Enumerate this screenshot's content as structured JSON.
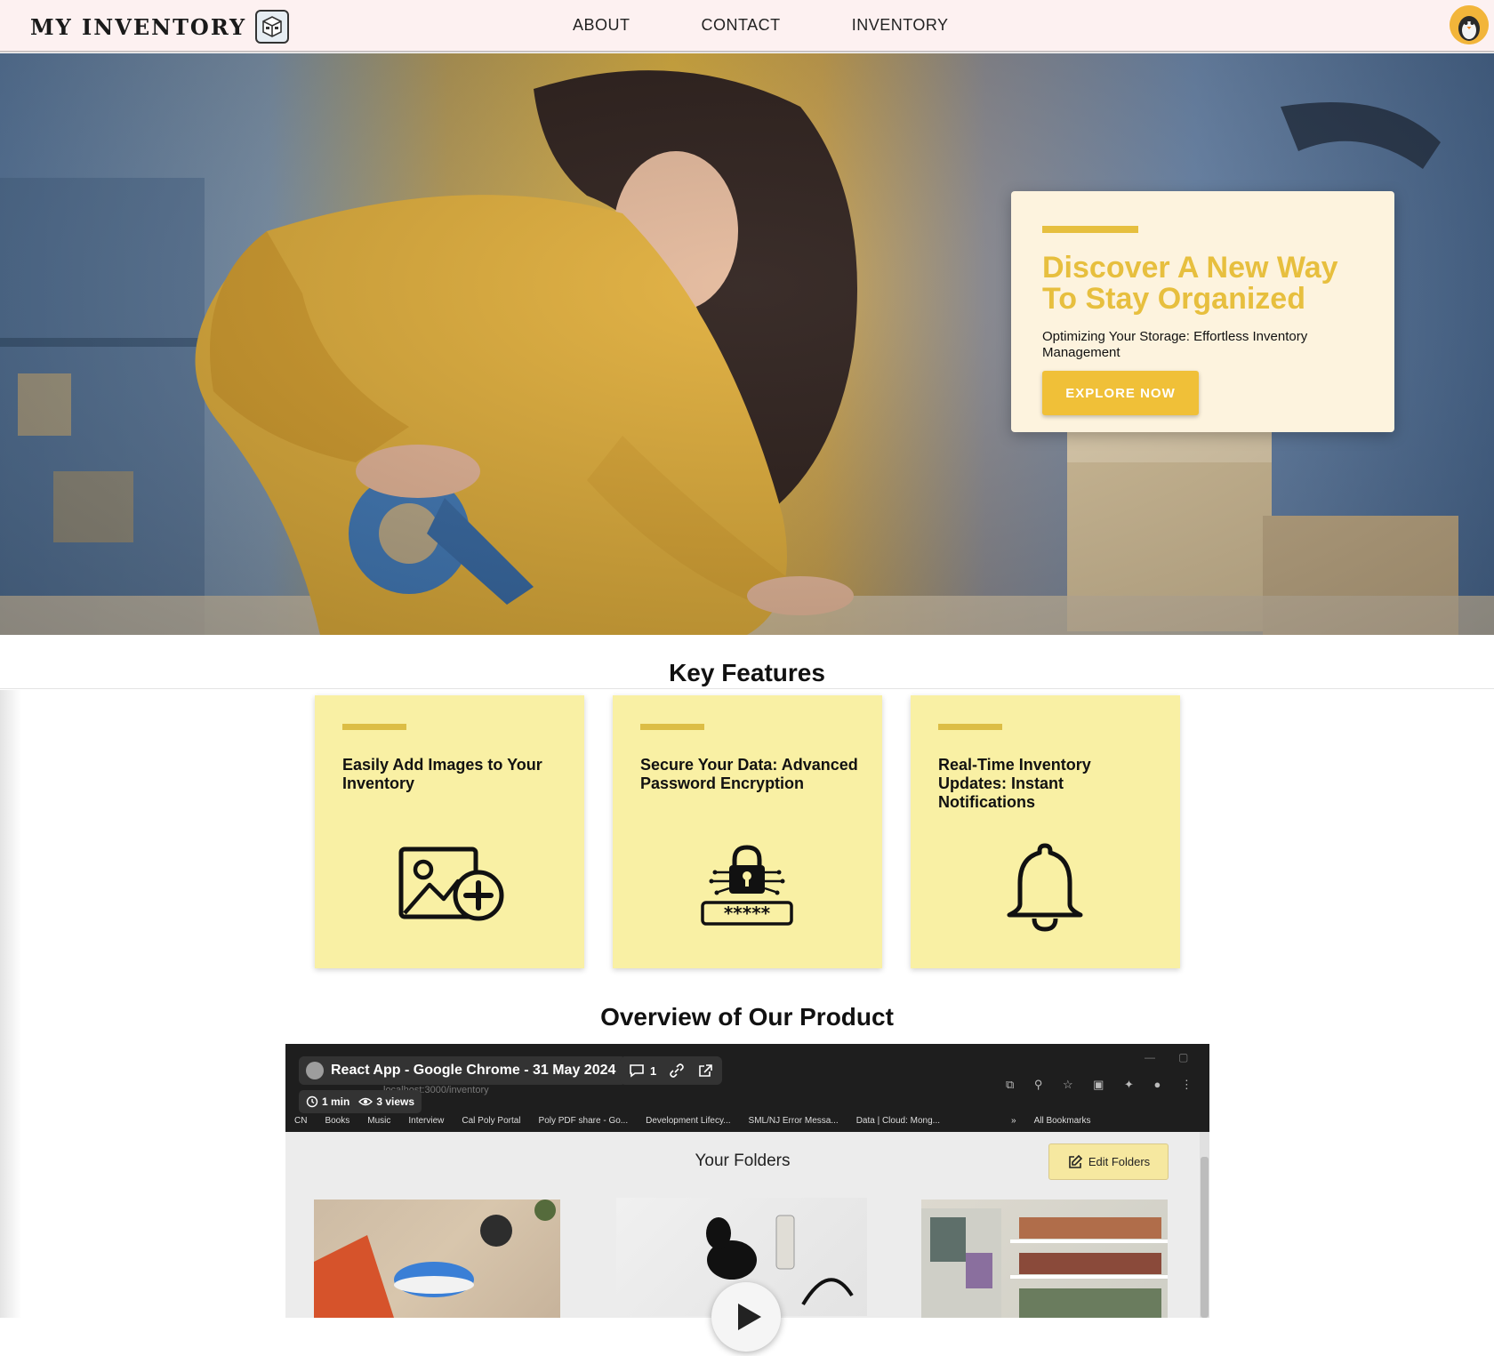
{
  "navbar": {
    "brand": "MY INVENTORY",
    "links": [
      "ABOUT",
      "CONTACT",
      "INVENTORY"
    ]
  },
  "hero": {
    "title": "Discover A New Way To Stay Organized",
    "subtitle": "Optimizing Your Storage: Effortless Inventory Management",
    "cta": "EXPLORE NOW"
  },
  "features": {
    "title": "Key Features",
    "items": [
      {
        "text": "Easily Add Images to Your Inventory",
        "icon": "add-image-icon"
      },
      {
        "text": "Secure Your Data: Advanced Password Encryption",
        "icon": "password-lock-icon"
      },
      {
        "text": "Real-Time Inventory Updates: Instant Notifications",
        "icon": "bell-icon"
      }
    ]
  },
  "overview": {
    "title": "Overview of Our Product",
    "video": {
      "title": "React App - Google Chrome - 31 May 2024",
      "comments": "1",
      "duration": "1 min",
      "views": "3 views",
      "url": "localhost:3000/inventory",
      "bookmarks": [
        "CN",
        "Books",
        "Music",
        "Interview",
        "Cal Poly Portal",
        "Poly PDF share - Go...",
        "Development Lifecy...",
        "SML/NJ Error Messa...",
        "Data | Cloud: Mong...",
        "»",
        "All Bookmarks"
      ],
      "folders_title": "Your Folders",
      "edit_folders": "Edit Folders"
    }
  },
  "colors": {
    "accent": "#e7bf3e",
    "card_bg": "#f9f0a4",
    "nav_bg": "#fdf1f1"
  }
}
